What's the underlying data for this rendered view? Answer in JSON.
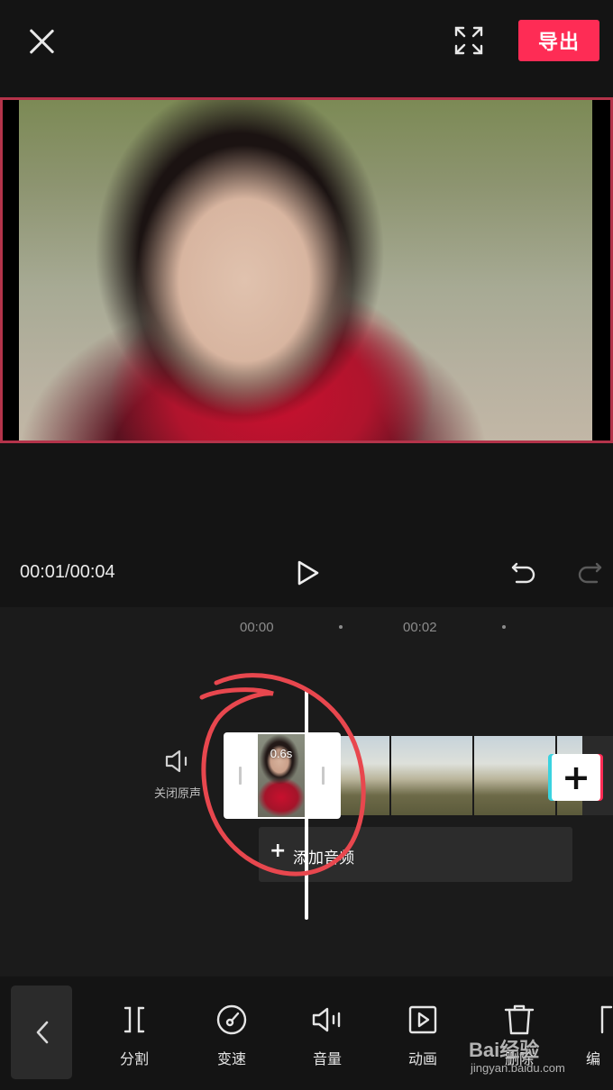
{
  "header": {
    "export_label": "导出"
  },
  "player": {
    "time_current": "00:01",
    "time_total": "00:04",
    "time_display": "00:01/00:04"
  },
  "timeline": {
    "ruler": [
      "00:00",
      "00:02"
    ],
    "mute_label": "关闭原声",
    "selected_clip_duration": "0.6s",
    "add_audio_label": "添加音频",
    "add_clip_symbol": "+"
  },
  "toolbar": {
    "tools": [
      {
        "label": "分割",
        "icon": "split-icon"
      },
      {
        "label": "变速",
        "icon": "speed-icon"
      },
      {
        "label": "音量",
        "icon": "volume-icon"
      },
      {
        "label": "动画",
        "icon": "animation-icon"
      },
      {
        "label": "删除",
        "icon": "delete-icon"
      },
      {
        "label": "编",
        "icon": "edit-icon"
      }
    ]
  },
  "watermark": {
    "brand": "Bai经验",
    "url": "jingyan.baidu.com"
  },
  "colors": {
    "accent": "#fe2c55",
    "annotation": "#e8474e",
    "preview_border": "#b4334a"
  }
}
